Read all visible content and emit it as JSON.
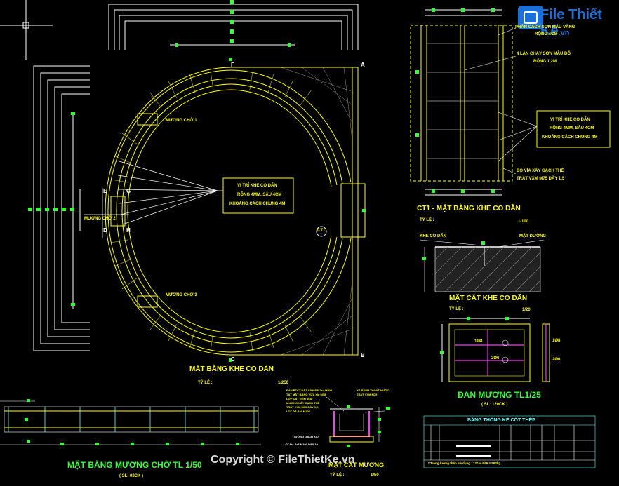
{
  "watermark": {
    "logo_text": "File Thiết Kế",
    "logo_suffix": ".vn",
    "copyright": "Copyright © FileThietKe.vn"
  },
  "main_plan": {
    "title": "MẶT BẰNG KHE CO DÃN",
    "scale_label": "TỶ LỆ :",
    "scale_value": "1/250",
    "note_joint": [
      "VỊ TRÍ KHE CO DÃN",
      "RỘNG 4MM, SÂU 4CM",
      "KHOẢNG CÁCH CHUNG 4M"
    ],
    "label_chu1": "MƯƠNG CHỜ 1",
    "label_chu2": "MƯƠNG CHỜ 2",
    "label_chu3": "MƯƠNG CHỜ 3",
    "ct1_tag": "CT1",
    "letters": {
      "a": "A",
      "b": "B",
      "c": "C",
      "d": "D",
      "e": "E",
      "f": "F",
      "g": "G",
      "h": "H"
    }
  },
  "ct1_detail": {
    "title": "CT1 - MẶT BẰNG KHE CO DÃN",
    "scale_label": "TỶ LỆ :",
    "scale_value": "1/100",
    "note1": [
      "PHÂN CÁCH SƠN MÀU VÀNG",
      "RỘNG 4CM"
    ],
    "note2": [
      "4 LÀN CHẠY SƠN MÀU ĐỎ",
      "RỘNG 1,2M"
    ],
    "note3": [
      "VỊ TRÍ KHE CO DÃN",
      "RỘNG 4MM, SÂU 4CM",
      "KHOẢNG CÁCH CHUNG 4M"
    ],
    "note4": [
      "BÓ VỈA XÂY GẠCH THẺ",
      "TRÁT VXM M75 DÀY 1,5"
    ]
  },
  "section_detail": {
    "title": "MẶT CẮT KHE CO DÃN",
    "scale_label": "TỶ LỆ :",
    "scale_value": "1/20",
    "label_joint": "KHE CO DÃN",
    "label_surface": "MẶT ĐƯỜNG"
  },
  "cover_slab": {
    "title": "ĐAN MƯƠNG TL1/25",
    "subtitle": "( SL: 120CK )",
    "dim1": "1Ø8",
    "dim2": "2Ø6",
    "dim3": "1Ø8",
    "dim4": "2Ø6"
  },
  "ditch_plan": {
    "title": "MẶT BẰNG MƯƠNG CHỜ TL 1/50",
    "subtitle": "( SL: 03CK )"
  },
  "ditch_section": {
    "title": "MẶT CẮT MƯƠNG",
    "scale_label": "TỶ LỆ :",
    "scale_value": "1/50",
    "notes_left": [
      "ĐAN BTCT ĐẶT SẴN ĐÁ 2x4 M200",
      "TẤT MẶT BẰNG VỮA XM M75",
      "LỚP CÁT ĐỆM 3CM",
      "MƯƠNG XÂY GẠCH THẺ",
      "TRÁT VXM M75 DÀY 1,5",
      "LÓT ĐÁ 4x6 M100"
    ],
    "notes_right": [
      "XẺ RÃNH THOÁT NƯỚC",
      "TRÁT VXM M75"
    ],
    "label_pipe": "TƯỜNG GẠCH XÂY",
    "label_base": "LÓT ĐÁ 4x6 M100 DÀY 10"
  },
  "rebar_table": {
    "title": "BẢNG THỐNG KÊ CỐT THÉP",
    "footer": "* Trong lượng thép sử dụng : 120 x 4,96 = 592kg"
  },
  "colors": {
    "yellow": "#ffff00",
    "green": "#33ff33",
    "cyan": "#66ffff",
    "white": "#ffffff",
    "magenta": "#ff33ff",
    "background": "#000000"
  }
}
